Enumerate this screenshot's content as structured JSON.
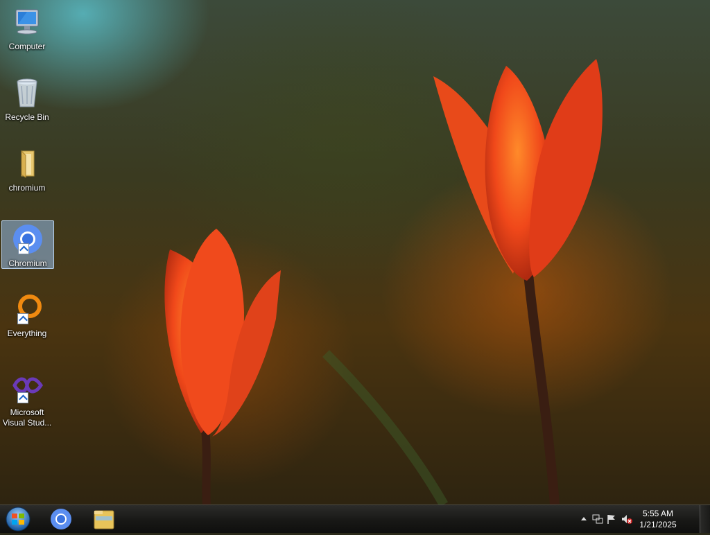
{
  "desktop_icons": [
    {
      "label": "Computer",
      "icon": "computer-icon"
    },
    {
      "label": "Recycle Bin",
      "icon": "recycle-bin-icon"
    },
    {
      "label": "chromium",
      "icon": "folder-icon"
    },
    {
      "label": "Chromium",
      "icon": "chromium-icon",
      "selected": true,
      "shortcut": true
    },
    {
      "label": "Everything",
      "icon": "everything-icon",
      "shortcut": true
    },
    {
      "label": "Microsoft Visual Stud...",
      "icon": "visual-studio-icon",
      "shortcut": true
    }
  ],
  "taskbar": {
    "start_icon": "windows-start-orb",
    "pinned": [
      "chromium-icon",
      "file-explorer-icon"
    ],
    "tray_icons": [
      "show-hidden-icons-arrow",
      "network-icon",
      "action-center-flag-icon",
      "volume-muted-icon"
    ],
    "clock": {
      "time": "5:55 AM",
      "date": "1/21/2025"
    }
  }
}
